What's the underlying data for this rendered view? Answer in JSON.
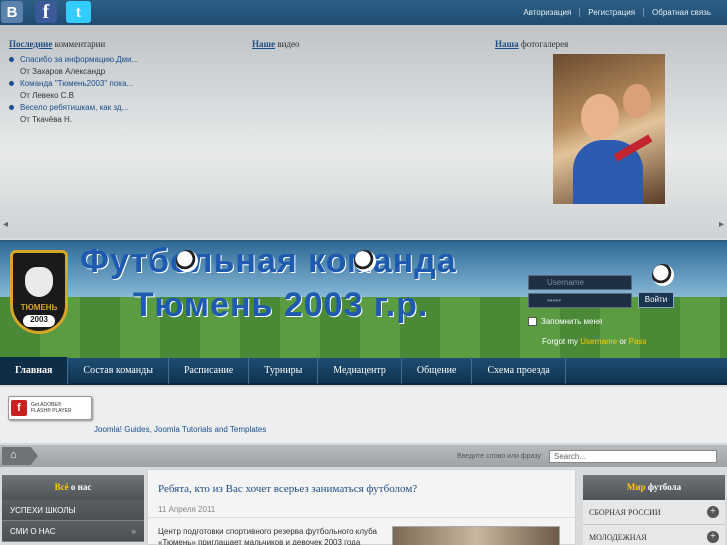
{
  "top": {
    "social": {
      "vk": "B",
      "facebook": "f",
      "twitter": "t"
    },
    "links": [
      "Авторизация",
      "Регистрация",
      "Обратная связь"
    ]
  },
  "modules": {
    "comments": {
      "title_bold": "Последние",
      "title_rest": "комментарии"
    },
    "video": {
      "title_bold": "Наше",
      "title_rest": "видео"
    },
    "photo": {
      "title_bold": "Наша",
      "title_rest": "фотогалерея"
    }
  },
  "comments": [
    {
      "text": "Спасибо за информацию.Дми...",
      "author": "От Захаров Александр"
    },
    {
      "text": "Команда \"Тюмень2003\" пока...",
      "author": "От Левеко С.В"
    },
    {
      "text": "Весело ребятишкам, как зд...",
      "author": "От Ткачёва Н."
    }
  ],
  "banner": {
    "line1": "Футбольная команда",
    "line2": "Тюмень 2003 г.р.",
    "logo_text": "ТЮМЕНЬ",
    "logo_year": "2003"
  },
  "login": {
    "username_placeholder": "Username",
    "password_placeholder": "•••••",
    "button": "Войти",
    "remember": "Запомнить меня",
    "forgot_prefix": "Forgot my",
    "forgot_user": "Username",
    "forgot_or": "or",
    "forgot_pass": "Pass"
  },
  "nav": [
    "Главная",
    "Состав команды",
    "Расписание",
    "Турниры",
    "Медиацентр",
    "Общение",
    "Схема проезда"
  ],
  "flash": {
    "icon": "f",
    "line1": "Get ADOBE®",
    "line2": "FLASH® PLAYER"
  },
  "joomla_link": "Joomla! Guides, Joomla Tutorials and Templates",
  "search": {
    "label": "Введите слово или фразу",
    "placeholder": "Search..."
  },
  "left": {
    "head_bold": "Всё",
    "head_rest": "о нас",
    "items": [
      "УСПЕХИ ШКОЛЫ",
      "СМИ О НАС"
    ]
  },
  "article": {
    "title": "Ребята, кто из Вас хочет всерьез заниматься футболом?",
    "date": "11 Апреля 2011",
    "text": "Центр подготовки спортивного резерва футбольного клуба «Тюмень» приглашает мальчиков и девочек 2003 года"
  },
  "right": {
    "head_bold": "Мир",
    "head_rest": "футбола",
    "items": [
      "СБОРНАЯ РОССИИ",
      "МОЛОДЕЖНАЯ"
    ]
  },
  "colors": {
    "accent": "#1d4e87",
    "nav_bg": "#0f3350",
    "highlight": "#ffcc00"
  }
}
